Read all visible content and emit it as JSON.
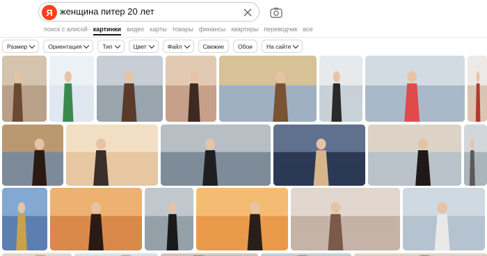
{
  "search": {
    "logo_letter": "Я",
    "query": "женщина питер 20 лет"
  },
  "nav": {
    "tabs": [
      "поиск с алисой",
      "картинки",
      "видео",
      "карты",
      "товары",
      "финансы",
      "квартиры",
      "переводчик",
      "все"
    ],
    "active": "картинки"
  },
  "filters": [
    {
      "label": "Размер",
      "dropdown": true
    },
    {
      "label": "Ориентация",
      "dropdown": true
    },
    {
      "label": "Тип",
      "dropdown": true
    },
    {
      "label": "Цвет",
      "dropdown": true
    },
    {
      "label": "Файл",
      "dropdown": true
    },
    {
      "label": "Свежие",
      "dropdown": false
    },
    {
      "label": "Обои",
      "dropdown": false
    },
    {
      "label": "На сайте",
      "dropdown": true
    }
  ],
  "icons": {
    "clear": "close-icon",
    "camera": "camera-search-icon"
  },
  "colors": {
    "logo": "#fc3f1d",
    "chip_border": "#d6d6d6"
  }
}
